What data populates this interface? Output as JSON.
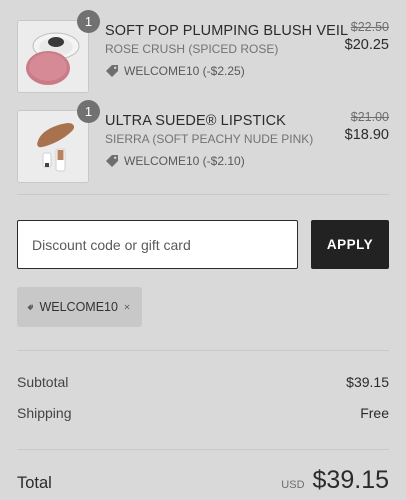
{
  "items": [
    {
      "quantity": "1",
      "name": "SOFT POP PLUMPING BLUSH VEIL",
      "variant": "ROSE CRUSH (SPICED ROSE)",
      "discount": "WELCOME10 (-$2.25)",
      "original_price": "$22.50",
      "price": "$20.25",
      "image_icon": "blush-compact-icon"
    },
    {
      "quantity": "1",
      "name": "ULTRA SUEDE® LIPSTICK",
      "variant": "SIERRA (SOFT PEACHY NUDE PINK)",
      "discount": "WELCOME10 (-$2.10)",
      "original_price": "$21.00",
      "price": "$18.90",
      "image_icon": "lipstick-icon"
    }
  ],
  "discount_form": {
    "placeholder": "Discount code or gift card",
    "apply_label": "APPLY"
  },
  "applied_code": {
    "label": "WELCOME10"
  },
  "summary": {
    "subtotal_label": "Subtotal",
    "subtotal_value": "$39.15",
    "shipping_label": "Shipping",
    "shipping_value": "Free",
    "total_label": "Total",
    "currency": "USD",
    "total_value": "$39.15"
  },
  "colors": {
    "background": "#d9d9d9",
    "button": "#222222",
    "badge": "#717171"
  }
}
